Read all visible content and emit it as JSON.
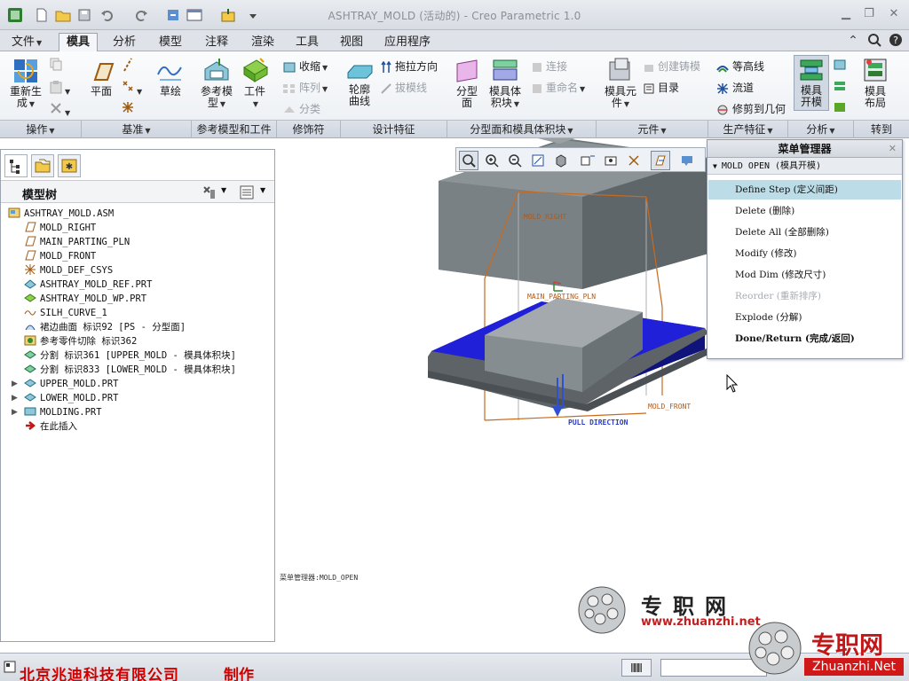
{
  "window": {
    "title": "ASHTRAY_MOLD (活动的) - Creo Parametric 1.0"
  },
  "tabs": [
    {
      "label": "文件",
      "active": false
    },
    {
      "label": "模具",
      "active": true
    },
    {
      "label": "分析",
      "active": false
    },
    {
      "label": "模型",
      "active": false
    },
    {
      "label": "注释",
      "active": false
    },
    {
      "label": "渲染",
      "active": false
    },
    {
      "label": "工具",
      "active": false
    },
    {
      "label": "视图",
      "active": false
    },
    {
      "label": "应用程序",
      "active": false
    }
  ],
  "ribbon": {
    "regenerate": "重新生",
    "regenerate2": "成",
    "plane": "平面",
    "sketch": "草绘",
    "ref_model": "参考模",
    "ref_model2": "型",
    "workpiece": "工件",
    "shrink": "收缩",
    "pattern": "阵列",
    "classify": "分类",
    "silhouette": "轮廓",
    "silhouette2": "曲线",
    "drag_direction": "拖拉方向",
    "draft_line": "拔模线",
    "parting_surface": "分型",
    "parting_surface2": "面",
    "volume_block": "模具体",
    "volume_block2": "积块",
    "connect": "连接",
    "rename": "重命名",
    "mold_component": "模具元",
    "mold_component2": "件",
    "create_casting": "创建铸模",
    "catalog": "目录",
    "contour": "等高线",
    "flow": "流道",
    "trim_geometry": "修剪到几何",
    "mold_open": "模具",
    "mold_open2": "开模",
    "mold_layout": "模具",
    "mold_layout2": "布局",
    "groups": {
      "operations": "操作",
      "datum": "基准",
      "ref_workpiece": "参考模型和工件",
      "modifiers": "修饰符",
      "design_features": "设计特征",
      "parting_volume": "分型面和模具体积块",
      "components": "元件",
      "production": "生产特征",
      "analysis": "分析",
      "goto": "转到"
    }
  },
  "model_tree": {
    "title": "模型树",
    "items": [
      "ASHTRAY_MOLD.ASM",
      "MOLD_RIGHT",
      "MAIN_PARTING_PLN",
      "MOLD_FRONT",
      "MOLD_DEF_CSYS",
      "ASHTRAY_MOLD_REF.PRT",
      "ASHTRAY_MOLD_WP.PRT",
      "SILH_CURVE_1",
      "裙边曲面 标识92 [PS - 分型面]",
      "参考零件切除 标识362",
      "分割 标识361 [UPPER_MOLD - 模具体积块]",
      "分割 标识833 [LOWER_MOLD - 模具体积块]",
      "UPPER_MOLD.PRT",
      "LOWER_MOLD.PRT",
      "MOLDING.PRT",
      "在此插入"
    ]
  },
  "viewport": {
    "labels": {
      "mold_right": "MOLD_RIGHT",
      "main_parting": "MAIN_PARTING_PLN",
      "mold_front": "MOLD_FRONT",
      "pull_direction": "PULL DIRECTION"
    },
    "message": "菜单管理器:MOLD_OPEN"
  },
  "menu_manager": {
    "title": "菜单管理器",
    "submenu": "MOLD OPEN (模具开模)",
    "items": [
      {
        "label": "Define Step (定义间距)",
        "selected": true,
        "enabled": true
      },
      {
        "label": "Delete (删除)",
        "selected": false,
        "enabled": true
      },
      {
        "label": "Delete All (全部删除)",
        "selected": false,
        "enabled": true
      },
      {
        "label": "Modify (修改)",
        "selected": false,
        "enabled": true
      },
      {
        "label": "Mod Dim (修改尺寸)",
        "selected": false,
        "enabled": true
      },
      {
        "label": "Reorder (重新排序)",
        "selected": false,
        "enabled": false
      },
      {
        "label": "Explode (分解)",
        "selected": false,
        "enabled": true
      },
      {
        "label": "Done/Return (完成/返回)",
        "selected": false,
        "enabled": true
      }
    ]
  },
  "status": {
    "credit": "北京兆迪科技有限公司",
    "credit_suffix": "制作"
  },
  "watermark": {
    "brand": "专职网",
    "url": "www.zhuanzhi.net",
    "brand2": "专职网",
    "url2": "Zhuanzhi.Net"
  },
  "colors": {
    "accent_tab": "#f4f6f9",
    "selection": "#bcdde8",
    "mold_gray": "#7f868a",
    "lower_plate": "#1818c8",
    "datum_orange": "#c86a1e",
    "credit_red": "#d00000"
  }
}
